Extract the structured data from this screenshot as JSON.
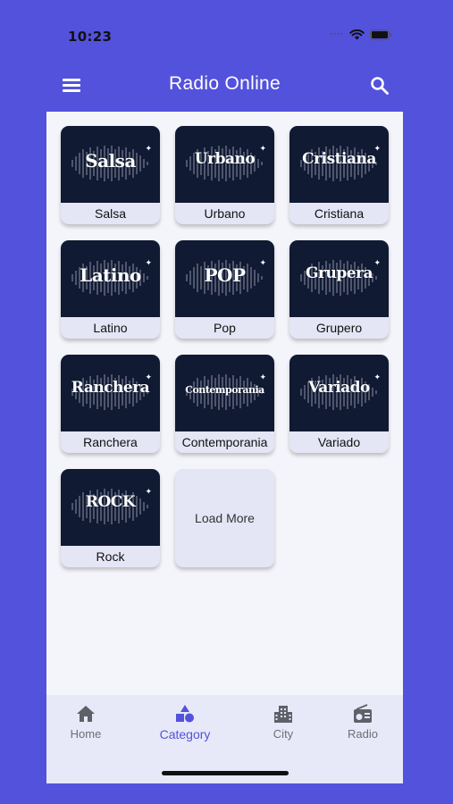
{
  "status_bar": {
    "time": "10:23"
  },
  "app_bar": {
    "title": "Radio Online",
    "menu_icon": "menu-icon",
    "search_icon": "search-icon"
  },
  "categories": [
    {
      "art": "Salsa",
      "label": "Salsa"
    },
    {
      "art": "Urbano",
      "label": "Urbano"
    },
    {
      "art": "Cristiana",
      "label": "Cristiana"
    },
    {
      "art": "Latino",
      "label": "Latino"
    },
    {
      "art": "POP",
      "label": "Pop"
    },
    {
      "art": "Grupera",
      "label": "Grupero"
    },
    {
      "art": "Ranchera",
      "label": "Ranchera"
    },
    {
      "art": "Contemporania",
      "label": "Contemporania"
    },
    {
      "art": "Variado",
      "label": "Variado"
    },
    {
      "art": "ROCK",
      "label": "Rock"
    }
  ],
  "load_more": {
    "label": "Load More"
  },
  "bottom_nav": {
    "items": [
      {
        "label": "Home",
        "icon": "home-icon",
        "active": false
      },
      {
        "label": "Category",
        "icon": "category-icon",
        "active": true
      },
      {
        "label": "City",
        "icon": "city-icon",
        "active": false
      },
      {
        "label": "Radio",
        "icon": "radio-icon",
        "active": false
      }
    ]
  },
  "colors": {
    "brand": "#5352dc",
    "card_art_bg": "#111a33",
    "card_bg": "#e4e5f5",
    "content_bg": "#f4f5fa"
  }
}
